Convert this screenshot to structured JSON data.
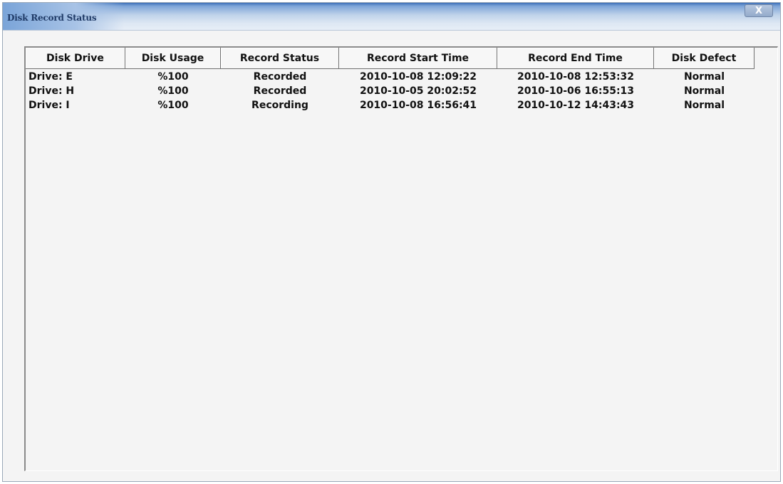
{
  "window": {
    "title": "Disk Record Status",
    "close_glyph": "X"
  },
  "table": {
    "columns": [
      "Disk Drive",
      "Disk Usage",
      "Record Status",
      "Record Start Time",
      "Record End Time",
      "Disk Defect"
    ],
    "rows": [
      [
        "Drive: E",
        "%100",
        "Recorded",
        "2010-10-08 12:09:22",
        "2010-10-08 12:53:32",
        "Normal"
      ],
      [
        "Drive: H",
        "%100",
        "Recorded",
        "2010-10-05 20:02:52",
        "2010-10-06 16:55:13",
        "Normal"
      ],
      [
        "Drive: I",
        "%100",
        "Recording",
        "2010-10-08 16:56:41",
        "2010-10-12 14:43:43",
        "Normal"
      ]
    ]
  },
  "colors": {
    "titlebar": "#c0d3ea",
    "title_text": "#1f3a66",
    "body": "#f4f4f4"
  },
  "icons": {
    "close": "close-icon"
  }
}
